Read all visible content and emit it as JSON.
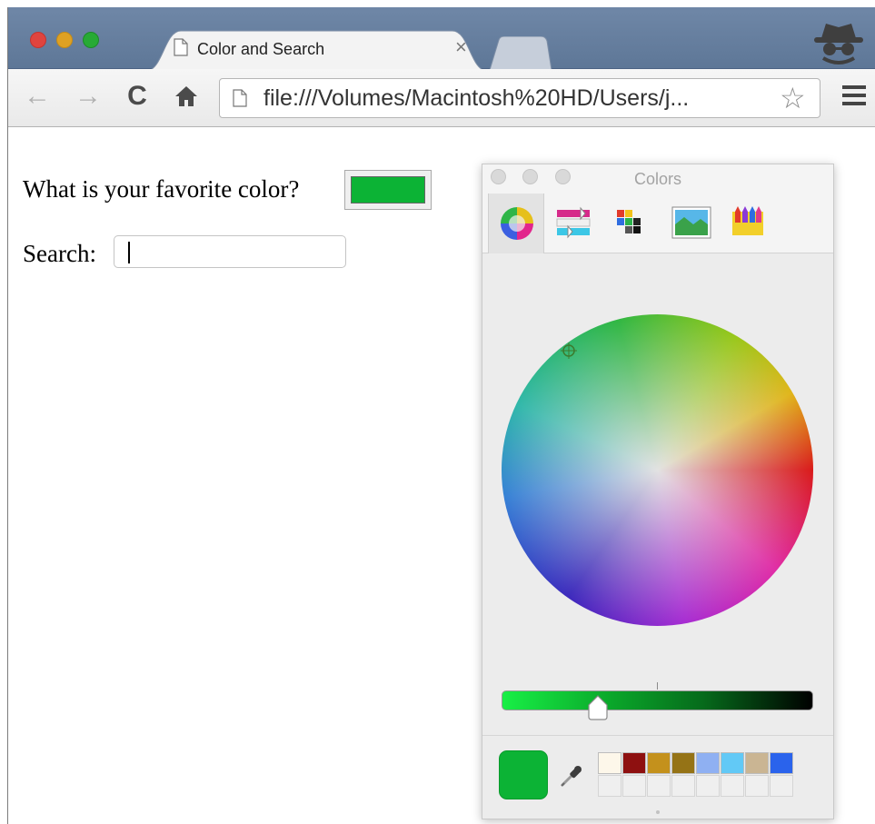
{
  "browser": {
    "tab_title": "Color and Search",
    "tab_close": "×",
    "url": "file:///Volumes/Macintosh%20HD/Users/j...",
    "back_icon": "back-arrow-icon",
    "forward_icon": "forward-arrow-icon",
    "reload_icon": "reload-icon",
    "home_icon": "home-icon",
    "bookmark_icon": "star-icon",
    "menu_icon": "hamburger-menu-icon",
    "profile_icon": "incognito-icon"
  },
  "page": {
    "color_label": "What is your favorite color?",
    "color_value": "#0cb335",
    "search_label": "Search:",
    "search_value": ""
  },
  "colors_panel": {
    "title": "Colors",
    "modes": [
      "color-wheel",
      "color-sliders",
      "color-palettes",
      "image-palettes",
      "pencils"
    ],
    "active_mode": "color-wheel",
    "current_color": "#0cb335",
    "brightness": 0.31,
    "swatches": [
      "#fdf7ea",
      "#8e1010",
      "#c4911c",
      "#957316",
      "#8fb0f2",
      "#62c9f6",
      "#cab593",
      "#2a63ec"
    ],
    "empty_swatch_count": 8
  }
}
